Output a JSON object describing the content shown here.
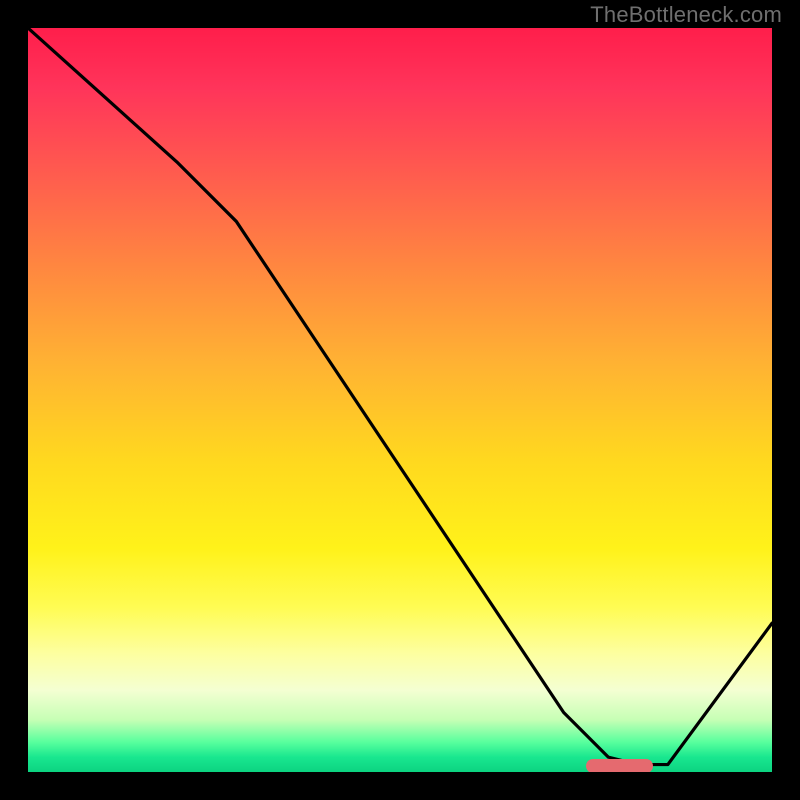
{
  "watermark": "TheBottleneck.com",
  "chart_data": {
    "type": "line",
    "title": "",
    "xlabel": "",
    "ylabel": "",
    "xlim": [
      0,
      100
    ],
    "ylim": [
      0,
      100
    ],
    "series": [
      {
        "name": "bottleneck-curve",
        "x": [
          0,
          10,
          20,
          28,
          40,
          52,
          64,
          72,
          78,
          82,
          86,
          100
        ],
        "y": [
          100,
          91,
          82,
          74,
          56,
          38,
          20,
          8,
          2,
          1,
          1,
          20
        ]
      }
    ],
    "marker": {
      "x_start": 75,
      "x_end": 84,
      "y": 0.8
    },
    "gradient_stops": [
      {
        "pos": 0,
        "color": "#ff1e4b"
      },
      {
        "pos": 33,
        "color": "#ff8a3f"
      },
      {
        "pos": 58,
        "color": "#ffd81f"
      },
      {
        "pos": 84,
        "color": "#fdff9f"
      },
      {
        "pos": 100,
        "color": "#0cd381"
      }
    ]
  }
}
